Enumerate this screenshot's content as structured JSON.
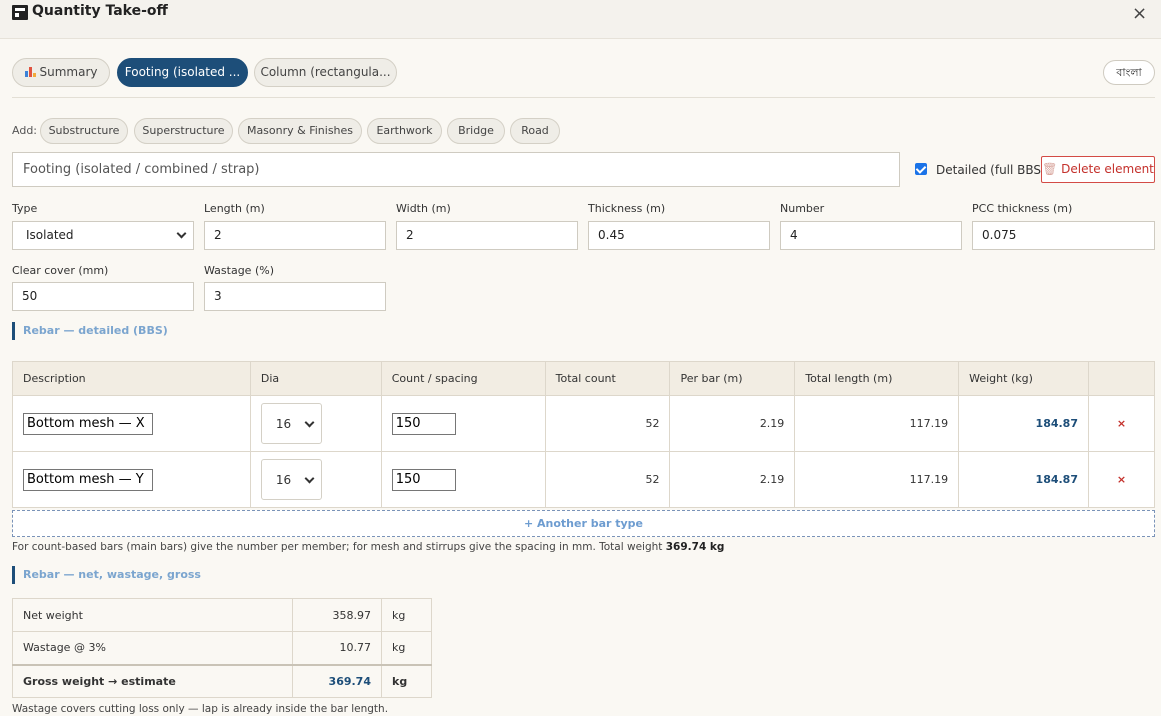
{
  "window": {
    "title": "Quantity Take-off",
    "close": "×"
  },
  "tabs": [
    {
      "label": "Summary"
    },
    {
      "label": "Footing (isolated ..."
    },
    {
      "label": "Column (rectangula..."
    }
  ],
  "lang_button": "বাংলা",
  "add_bar": {
    "label": "Add:",
    "chips": [
      "Substructure",
      "Superstructure",
      "Masonry & Finishes",
      "Earthwork",
      "Bridge",
      "Road"
    ]
  },
  "element": {
    "name": "Footing (isolated / combined / strap)",
    "detailed_label": "Detailed (full BBS)",
    "detailed_checked": true,
    "delete_label": "Delete element"
  },
  "fields": {
    "type": {
      "label": "Type",
      "value": "Isolated"
    },
    "length": {
      "label": "Length (m)",
      "value": "2"
    },
    "width": {
      "label": "Width (m)",
      "value": "2"
    },
    "thickness": {
      "label": "Thickness (m)",
      "value": "0.45"
    },
    "number": {
      "label": "Number",
      "value": "4"
    },
    "pcc": {
      "label": "PCC thickness (m)",
      "value": "0.075"
    },
    "cover": {
      "label": "Clear cover (mm)",
      "value": "50"
    },
    "wastage": {
      "label": "Wastage (%)",
      "value": "3"
    }
  },
  "bbs": {
    "heading": "Rebar — detailed (BBS)",
    "columns": [
      "Description",
      "Dia",
      "Count / spacing",
      "Total count",
      "Per bar (m)",
      "Total length (m)",
      "Weight (kg)",
      ""
    ],
    "rows": [
      {
        "description": "Bottom mesh — X",
        "dia": "16",
        "count": "150",
        "total_count": "52",
        "per_bar": "2.19",
        "total_length": "117.19",
        "weight": "184.87",
        "remove": "×"
      },
      {
        "description": "Bottom mesh — Y",
        "dia": "16",
        "count": "150",
        "total_count": "52",
        "per_bar": "2.19",
        "total_length": "117.19",
        "weight": "184.87",
        "remove": "×"
      }
    ],
    "add_label": "+ Another bar type",
    "note": "For count-based bars (main bars) give the number per member; for mesh and stirrups give the spacing in mm. Total weight",
    "total_weight": "369.74 kg"
  },
  "summary": {
    "heading": "Rebar — net, wastage, gross",
    "rows": [
      {
        "label": "Net weight",
        "value": "358.97",
        "unit": "kg"
      },
      {
        "label": "Wastage @ 3%",
        "value": "10.77",
        "unit": "kg"
      },
      {
        "label": "Gross weight → estimate",
        "value": "369.74",
        "unit": "kg"
      }
    ],
    "note": "Wastage covers cutting loss only — lap is already inside the bar length."
  },
  "colors": {
    "accent": "#1d4e79",
    "danger": "#c4302b",
    "link": "#6d9cd0"
  }
}
